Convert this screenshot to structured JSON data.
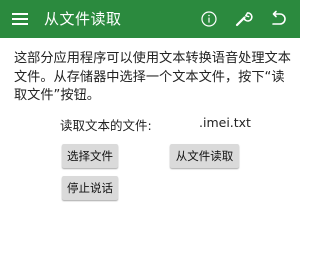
{
  "app_bar": {
    "title": "从文件读取",
    "background_color": "#2b8a3e",
    "icons": [
      "menu-icon",
      "info-icon",
      "wrench-icon",
      "back-icon"
    ]
  },
  "main": {
    "description": "这部分应用程序可以使用文本转换语音处理文本文件。从存储器中选择一个文本文件，按下“读取文件”按钮。",
    "file_label": "读取文本的文件:",
    "file_value": ".imei.txt",
    "buttons": {
      "select_file": "选择文件",
      "read_from_file": "从文件读取",
      "stop_talking": "停止说话"
    }
  }
}
